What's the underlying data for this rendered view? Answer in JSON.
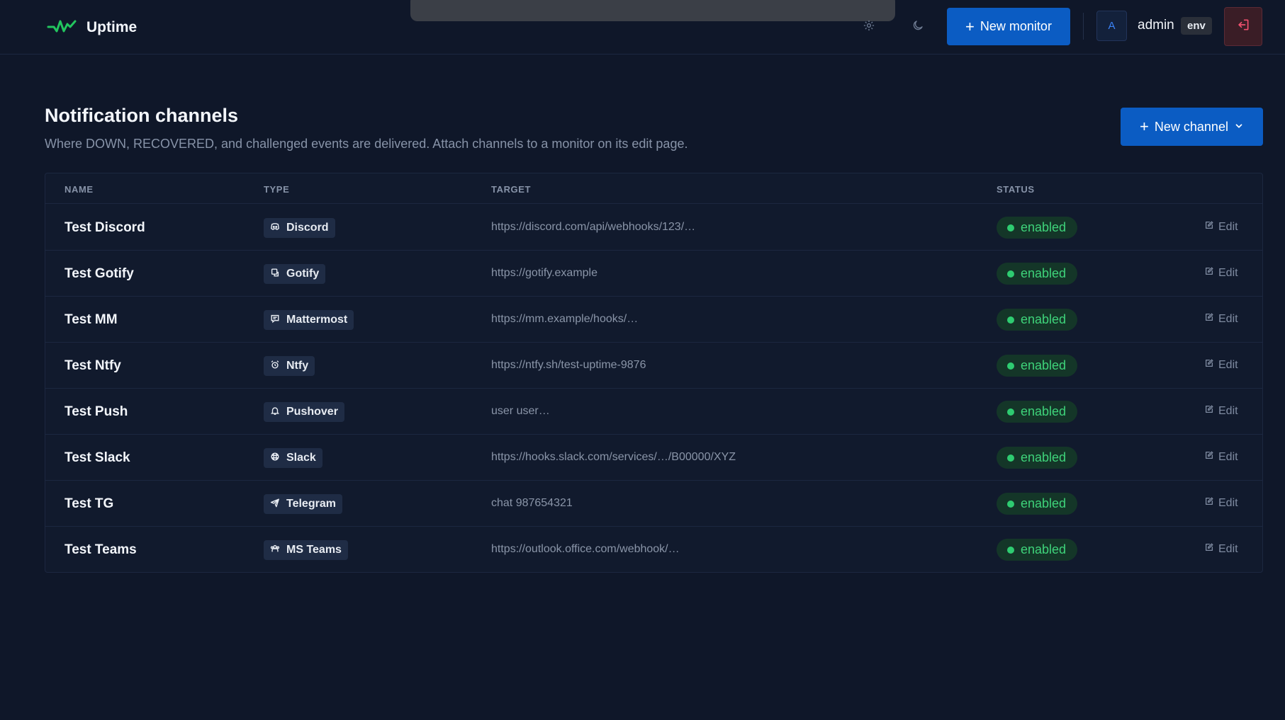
{
  "app": {
    "name": "Uptime"
  },
  "header": {
    "new_monitor_label": "New monitor",
    "avatar_initial": "A",
    "username": "admin",
    "env_badge": "env",
    "icons": [
      "logo-pulse-icon",
      "gear-icon",
      "moon-icon",
      "plus-icon",
      "logout-icon"
    ]
  },
  "page": {
    "title": "Notification channels",
    "description": "Where DOWN, RECOVERED, and challenged events are delivered. Attach channels to a monitor on its edit page.",
    "new_channel_label": "New channel"
  },
  "table": {
    "columns": [
      "NAME",
      "TYPE",
      "TARGET",
      "STATUS"
    ],
    "edit_label": "Edit",
    "rows": [
      {
        "name": "Test Discord",
        "type": "Discord",
        "type_icon": "discord-icon",
        "target": "https://discord.com/api/webhooks/123/…",
        "status": "enabled"
      },
      {
        "name": "Test Gotify",
        "type": "Gotify",
        "type_icon": "gotify-icon",
        "target": "https://gotify.example",
        "status": "enabled"
      },
      {
        "name": "Test MM",
        "type": "Mattermost",
        "type_icon": "mattermost-icon",
        "target": "https://mm.example/hooks/…",
        "status": "enabled"
      },
      {
        "name": "Test Ntfy",
        "type": "Ntfy",
        "type_icon": "ntfy-icon",
        "target": "https://ntfy.sh/test-uptime-9876",
        "status": "enabled"
      },
      {
        "name": "Test Push",
        "type": "Pushover",
        "type_icon": "pushover-icon",
        "target": "user user…",
        "status": "enabled"
      },
      {
        "name": "Test Slack",
        "type": "Slack",
        "type_icon": "slack-icon",
        "target": "https://hooks.slack.com/services/…/B00000/XYZ",
        "status": "enabled"
      },
      {
        "name": "Test TG",
        "type": "Telegram",
        "type_icon": "telegram-icon",
        "target": "chat 987654321",
        "status": "enabled"
      },
      {
        "name": "Test Teams",
        "type": "MS Teams",
        "type_icon": "teams-icon",
        "target": "https://outlook.office.com/webhook/…",
        "status": "enabled"
      }
    ]
  },
  "colors": {
    "background": "#0f1729",
    "accent": "#0b5cc3",
    "status_enabled": "#3ed37a",
    "logo": "#22c55e",
    "danger": "#f0506e"
  }
}
